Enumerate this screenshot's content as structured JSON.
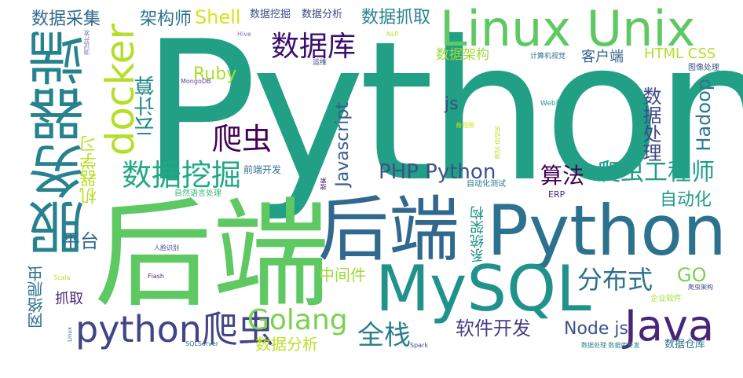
{
  "words": [
    {
      "text": "Python",
      "color": "#22a085"
    },
    {
      "text": "后端",
      "color": "#5ec962"
    },
    {
      "text": "后端",
      "color": "#31688e"
    },
    {
      "text": "Python",
      "color": "#2c728e"
    },
    {
      "text": "服务器端",
      "color": "#26828e"
    },
    {
      "text": "Linux Unix",
      "color": "#5ec962"
    },
    {
      "text": "MySQL",
      "color": "#21918c"
    },
    {
      "text": "docker",
      "color": "#b5de2b"
    },
    {
      "text": "数据库",
      "color": "#3b0f70"
    },
    {
      "text": "Java",
      "color": "#482677"
    },
    {
      "text": "python爬虫",
      "color": "#414487"
    },
    {
      "text": "数据挖掘",
      "color": "#22a884"
    },
    {
      "text": "爬虫",
      "color": "#440154"
    },
    {
      "text": "Golang",
      "color": "#7ad151"
    },
    {
      "text": "爬虫工程师",
      "color": "#1f9e89"
    },
    {
      "text": "PHP Python",
      "color": "#3b528b"
    },
    {
      "text": "分布式",
      "color": "#2d708e"
    },
    {
      "text": "数据抓取",
      "color": "#26828e"
    },
    {
      "text": "数据采集",
      "color": "#31688e"
    },
    {
      "text": "架构师",
      "color": "#2c728e"
    },
    {
      "text": "Shell",
      "color": "#d8e219"
    },
    {
      "text": "算法",
      "color": "#440154"
    },
    {
      "text": "全栈",
      "color": "#287d8e"
    },
    {
      "text": "Javascript",
      "color": "#355f8d"
    },
    {
      "text": "Hadoop",
      "color": "#2a788e"
    },
    {
      "text": "数据处理",
      "color": "#3e4989"
    },
    {
      "text": "云计算",
      "color": "#238a8d"
    },
    {
      "text": "机器学习",
      "color": "#b8de29"
    },
    {
      "text": "网络爬虫",
      "color": "#2c728e"
    },
    {
      "text": "Ruby",
      "color": "#addc30"
    },
    {
      "text": "软件开发",
      "color": "#433e85"
    },
    {
      "text": "Node js",
      "color": "#3b528b"
    },
    {
      "text": "数据分析",
      "color": "#bddf26"
    },
    {
      "text": "GO",
      "color": "#7ad151"
    },
    {
      "text": "自动化",
      "color": "#1f9e89"
    },
    {
      "text": "中间件",
      "color": "#a0da39"
    },
    {
      "text": "系统架构",
      "color": "#1f968b"
    },
    {
      "text": "平台",
      "color": "#31688e"
    },
    {
      "text": "抓取",
      "color": "#482475"
    },
    {
      "text": "js",
      "color": "#3e4989"
    },
    {
      "text": "HTML CSS",
      "color": "#b5de2b"
    },
    {
      "text": "客户端",
      "color": "#33638d"
    },
    {
      "text": "数据架构",
      "color": "#a2da37"
    },
    {
      "text": "数据挖掘",
      "color": "#3b528b"
    },
    {
      "text": "数据分析",
      "color": "#3e4989"
    },
    {
      "text": "数据仓库",
      "color": "#2b748e"
    },
    {
      "text": "前端开发",
      "color": "#2d708e"
    },
    {
      "text": "自然语言处理",
      "color": "#35b779"
    },
    {
      "text": "自动化测试",
      "color": "#2a788e"
    },
    {
      "text": "ERP",
      "color": "#472d7b"
    },
    {
      "text": "运维",
      "color": "#3e4989"
    },
    {
      "text": "计算机视觉",
      "color": "#2d708e"
    },
    {
      "text": "图像处理",
      "color": "#3b528b"
    },
    {
      "text": "MongoDB",
      "color": "#5e3c99"
    },
    {
      "text": "Hive",
      "color": "#7e7bb8"
    },
    {
      "text": "NLP",
      "color": "#bddf26"
    },
    {
      "text": "测试开发",
      "color": "#7e7bb8"
    },
    {
      "text": "Web前端",
      "color": "#1f9e89"
    },
    {
      "text": "音视频",
      "color": "#d2e21b"
    },
    {
      "text": "测试 自动化",
      "color": "#c2df23"
    },
    {
      "text": "搜索",
      "color": "#482475"
    },
    {
      "text": "人脸识别",
      "color": "#414487"
    },
    {
      "text": "Scala",
      "color": "#b5de2b"
    },
    {
      "text": "Flash",
      "color": "#482475"
    },
    {
      "text": "爬虫架构",
      "color": "#3e4989"
    },
    {
      "text": "企业软件",
      "color": "#a8db34"
    },
    {
      "text": "Linux",
      "color": "#31688e"
    },
    {
      "text": "SQLServer",
      "color": "#2c728e"
    },
    {
      "text": "Spark",
      "color": "#3e4989"
    },
    {
      "text": "数据处理 数据库开发",
      "color": "#26828e"
    }
  ]
}
